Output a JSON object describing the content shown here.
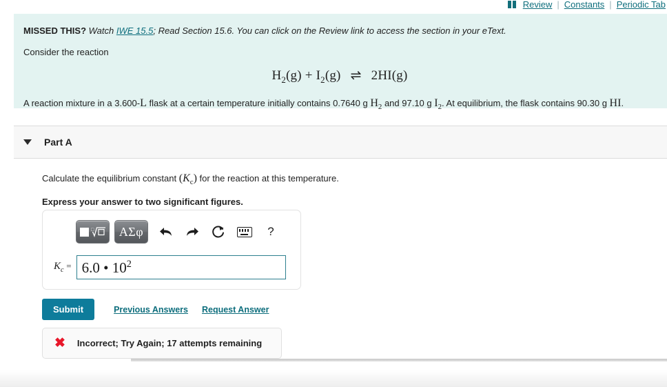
{
  "topnav": {
    "grid_icon": "grid-icon",
    "links": [
      "Review",
      "Constants",
      "Periodic Tab"
    ],
    "separator": "|"
  },
  "banner": {
    "missed_label": "MISSED THIS?",
    "watch_text": "Watch",
    "iwe_link": "IWE 15.5",
    "after_link": "; Read Section 15.6. You can click on the Review link to access the section in your eText.",
    "consider": "Consider the reaction",
    "equation": {
      "reactant1": "H",
      "reactant1_sub": "2",
      "reactant1_state": "(g)",
      "plus": "+",
      "reactant2": "I",
      "reactant2_sub": "2",
      "reactant2_state": "(g)",
      "arrow": "⇌",
      "product_coeff": "2",
      "product": "HI",
      "product_state": "(g)"
    },
    "mixture": {
      "part1": "A reaction mixture in a 3.600-",
      "volume_unit": "L",
      "part2": " flask at a certain temperature initially contains 0.7640 g ",
      "species1": "H",
      "species1_sub": "2",
      "part3": " and 97.10 g ",
      "species2": "I",
      "species2_sub": "2",
      "part4": ". At equilibrium, the flask contains 90.30 g ",
      "species3": "HI",
      "part5": "."
    }
  },
  "part": {
    "caret_icon": "caret-down-icon",
    "title": "Part A"
  },
  "question": {
    "text_before": "Calculate the equilibrium constant ",
    "symbol_open": "(",
    "symbol": "K",
    "symbol_sub": "c",
    "symbol_close": ")",
    "text_after": " for the reaction at this temperature.",
    "instruction": "Express your answer to two significant figures."
  },
  "answer": {
    "toolbar": [
      {
        "name": "math-template-button",
        "label": "",
        "icon": "radical-template-icon"
      },
      {
        "name": "greek-symbols-button",
        "label": "ΑΣφ",
        "icon": "greek-letters-icon"
      },
      {
        "name": "undo-button",
        "label": "↰",
        "icon": "undo-arrow-icon"
      },
      {
        "name": "redo-button",
        "label": "↱",
        "icon": "redo-arrow-icon"
      },
      {
        "name": "reset-button",
        "label": "↻",
        "icon": "reset-circle-icon"
      },
      {
        "name": "keyboard-button",
        "label": "",
        "icon": "keyboard-icon"
      },
      {
        "name": "help-button",
        "label": "?",
        "icon": "question-mark-icon"
      }
    ],
    "kc_symbol": "K",
    "kc_sub": "c",
    "kc_equals": "=",
    "value_mantissa": "6.0 • 10",
    "value_exponent": "2",
    "placeholder": ""
  },
  "actions": {
    "submit_label": "Submit",
    "previous_answers_label": "Previous Answers",
    "request_answer_label": "Request Answer"
  },
  "feedback": {
    "icon": "x-mark-icon",
    "icon_glyph": "✖",
    "message": "Incorrect; Try Again; 17 attempts remaining",
    "color": "#e8172a"
  },
  "colors": {
    "banner_bg": "#e3f3f1",
    "link": "#0e6e7d",
    "submit_bg": "#0e7c9b",
    "input_border": "#2d7f8e",
    "error": "#e8172a"
  }
}
